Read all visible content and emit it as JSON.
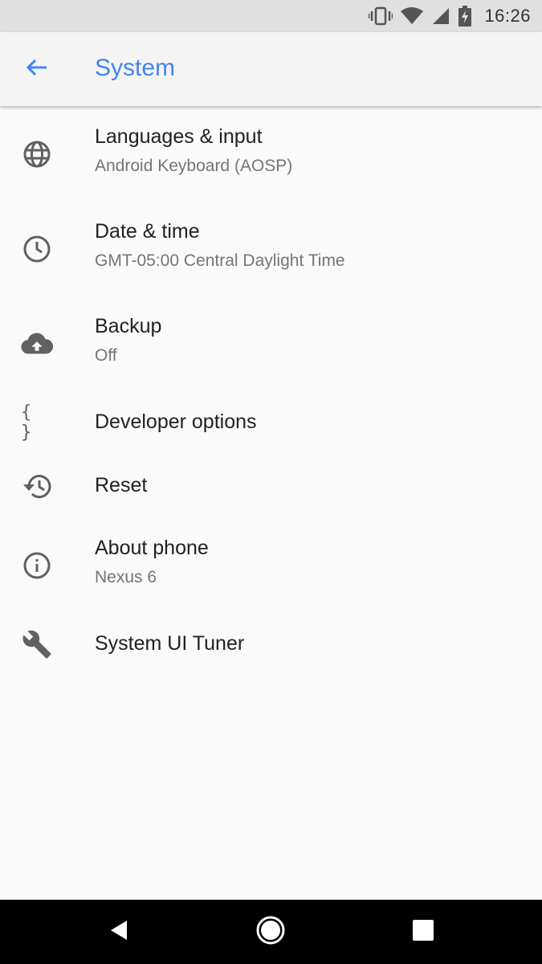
{
  "status_bar": {
    "time": "16:26",
    "icons": [
      "vibrate-icon",
      "wifi-icon",
      "cell-signal-icon",
      "battery-charging-icon"
    ]
  },
  "app_bar": {
    "title": "System",
    "back_icon": "arrow-back-icon",
    "accent_color": "#4285f4"
  },
  "settings": {
    "items": [
      {
        "title": "Languages & input",
        "summary": "Android Keyboard (AOSP)",
        "icon": "globe-icon"
      },
      {
        "title": "Date & time",
        "summary": "GMT-05:00 Central Daylight Time",
        "icon": "clock-icon"
      },
      {
        "title": "Backup",
        "summary": "Off",
        "icon": "cloud-upload-icon"
      },
      {
        "title": "Developer options",
        "icon": "code-braces-icon",
        "icon_text": "{ }"
      },
      {
        "title": "Reset",
        "icon": "restore-history-icon"
      },
      {
        "title": "About phone",
        "summary": "Nexus 6",
        "icon": "info-icon"
      },
      {
        "title": "System UI Tuner",
        "icon": "wrench-icon"
      }
    ]
  },
  "nav_bar": {
    "buttons": [
      "nav-back-icon",
      "nav-home-icon",
      "nav-recents-icon"
    ]
  }
}
